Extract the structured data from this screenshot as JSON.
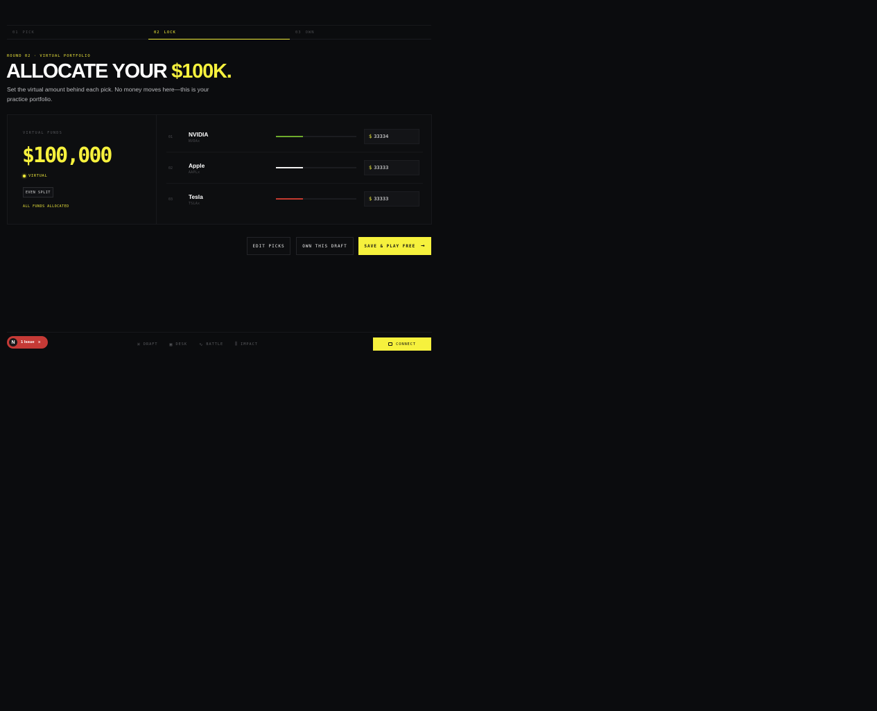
{
  "stepper": [
    {
      "num": "01",
      "label": "PICK",
      "active": false
    },
    {
      "num": "02",
      "label": "LOCK",
      "active": true
    },
    {
      "num": "03",
      "label": "OWN",
      "active": false
    }
  ],
  "header": {
    "kicker": "ROUND 02 · VIRTUAL PORTFOLIO",
    "title_main": "ALLOCATE YOUR ",
    "title_highlight": "$100K.",
    "subtitle": "Set the virtual amount behind each pick. No money moves here—this is your practice portfolio."
  },
  "funds": {
    "label": "VIRTUAL FUNDS",
    "amount": "$100,000",
    "badge": "VIRTUAL",
    "even_split": "EVEN SPLIT",
    "status": "ALL FUNDS ALLOCATED"
  },
  "picks": [
    {
      "index": "01",
      "name": "NVIDIA",
      "ticker": "NVDAx",
      "currency": "$",
      "amount": "33334",
      "allocation": 0.333,
      "color": "#6eab2c"
    },
    {
      "index": "02",
      "name": "Apple",
      "ticker": "AAPLx",
      "currency": "$",
      "amount": "33333",
      "allocation": 0.333,
      "color": "#f2f2f2"
    },
    {
      "index": "03",
      "name": "Tesla",
      "ticker": "TSLAx",
      "currency": "$",
      "amount": "33333",
      "allocation": 0.333,
      "color": "#c53a30"
    }
  ],
  "actions": {
    "edit": "EDIT PICKS",
    "own": "OWN THIS DRAFT",
    "save": "SAVE & PLAY FREE",
    "save_icon": "→"
  },
  "issues": {
    "logo": "N",
    "label": "1 Issue",
    "close": "×"
  },
  "nav": [
    {
      "icon": "⌘",
      "label": "DRAFT"
    },
    {
      "icon": "▣",
      "label": "DESK"
    },
    {
      "icon": "∿",
      "label": "BATTLE"
    },
    {
      "icon": "⫼",
      "label": "IMPACT"
    }
  ],
  "connect": {
    "label": "CONNECT"
  },
  "colors": {
    "accent": "#f6f13d",
    "background": "#0b0c0e",
    "issue": "#c53a36"
  }
}
